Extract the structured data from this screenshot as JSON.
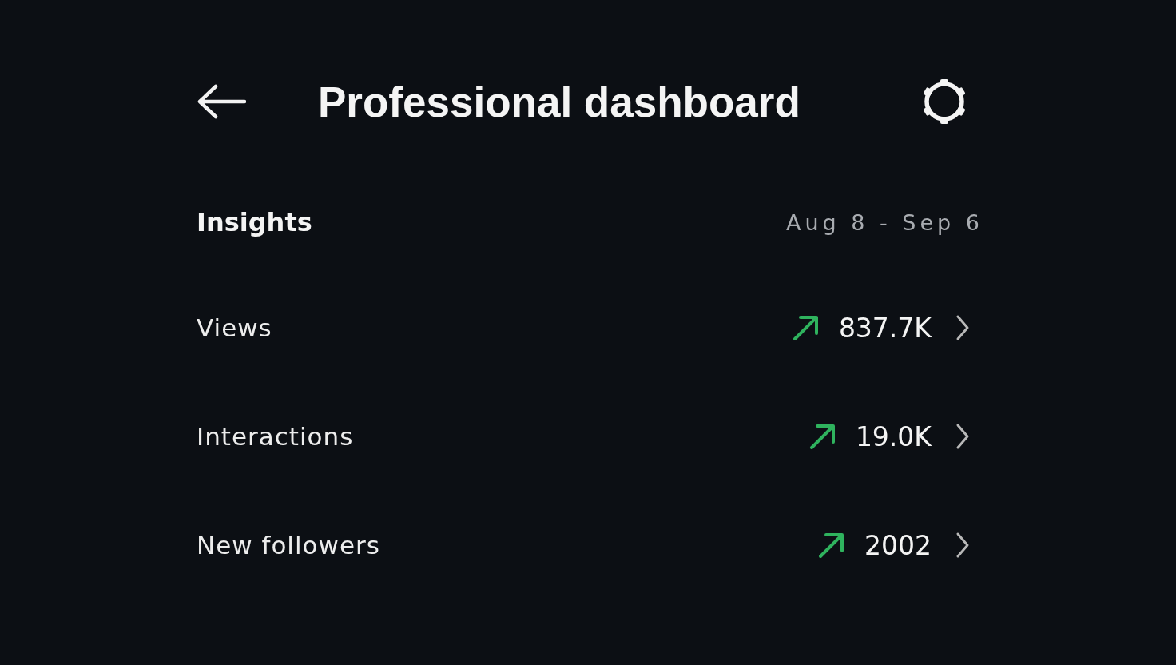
{
  "header": {
    "title": "Professional dashboard"
  },
  "insights": {
    "heading": "Insights",
    "date_range": "Aug 8 - Sep 6"
  },
  "metrics": [
    {
      "label": "Views",
      "rising": true,
      "value": "837.7K"
    },
    {
      "label": "Interactions",
      "rising": true,
      "value": "19.0K"
    },
    {
      "label": "New followers",
      "rising": true,
      "value": "2002"
    }
  ]
}
